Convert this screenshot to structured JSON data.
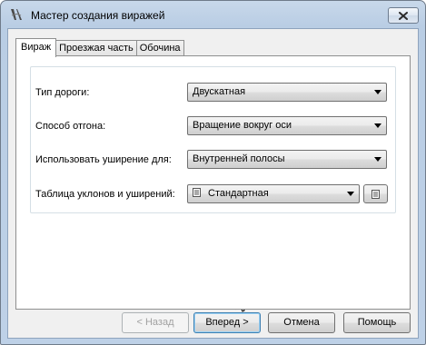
{
  "window": {
    "title": "Мастер создания виражей"
  },
  "tabs": [
    {
      "label": "Вираж",
      "active": true
    },
    {
      "label": "Проезжая часть",
      "active": false
    },
    {
      "label": "Обочина",
      "active": false
    }
  ],
  "form": {
    "road_type": {
      "label": "Тип дороги:",
      "value": "Двускатная"
    },
    "transition_method": {
      "label": "Способ отгона:",
      "value": "Вращение вокруг оси"
    },
    "widening": {
      "label": "Использовать уширение для:",
      "value": "Внутренней полосы"
    },
    "slope_table": {
      "label": "Таблица уклонов и уширений:",
      "value": "Стандартная"
    }
  },
  "buttons": {
    "back": "< Назад",
    "next": "Вперед >",
    "cancel": "Отмена",
    "help": "Помощь"
  },
  "colors": {
    "titlebar": "#bed1e7",
    "client": "#f0f0f0",
    "panel": "#ffffff",
    "default_button_border": "#3c7fb1"
  },
  "icons": {
    "title": "road-curve-icon",
    "close": "close-icon",
    "dropdown": "chevron-down-icon",
    "table": "table-icon"
  }
}
